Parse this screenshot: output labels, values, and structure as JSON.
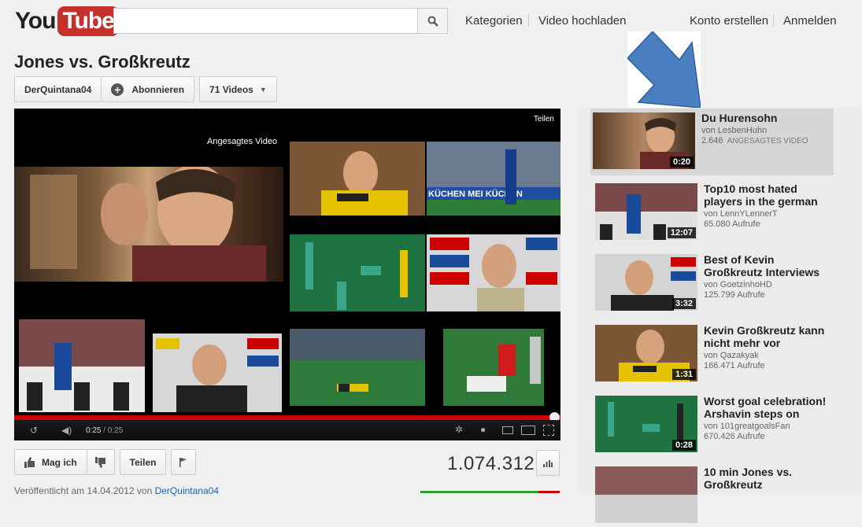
{
  "header": {
    "logo_you": "You",
    "logo_tube": "Tube",
    "search_placeholder": "",
    "nav": [
      "Kategorien",
      "Video hochladen"
    ],
    "account": [
      "Konto erstellen",
      "Anmelden"
    ]
  },
  "video": {
    "title": "Jones vs. Großkreutz",
    "channel": "DerQuintana04",
    "subscribe_label": "Abonnieren",
    "videos_count_label": "71 Videos",
    "views": "1.074.312",
    "published_prefix": "Veröffentlicht am 14.04.2012 von",
    "published_by": "DerQuintana04"
  },
  "player": {
    "share_label": "Teilen",
    "featured_label": "Angesagtes Video",
    "time_current": "0:25",
    "time_total": "/ 0:25",
    "progress_fraction": 0.98
  },
  "actions": {
    "like_label": "Mag ich",
    "share_label": "Teilen"
  },
  "colors": {
    "brand_red": "#c4302b",
    "link_blue": "#1c62b9",
    "arrow_blue": "#4a7fc1"
  },
  "sidebar": {
    "items": [
      {
        "title": "Du Hurensohn",
        "by": "von LesbenHuhn",
        "views": "2.646",
        "tag": "ANGESAGTES VIDEO",
        "duration": "0:20"
      },
      {
        "title": "Top10 most hated players in the german",
        "by": "von LennYLennerT",
        "views": "65.080 Aufrufe",
        "tag": "",
        "duration": "12:07"
      },
      {
        "title": "Best of Kevin Großkreutz Interviews",
        "by": "von GoetzinhoHD",
        "views": "125.799 Aufrufe",
        "tag": "",
        "duration": "3:32"
      },
      {
        "title": "Kevin Großkreutz kann nicht mehr vor",
        "by": "von Qazakyak",
        "views": "166.471 Aufrufe",
        "tag": "",
        "duration": "1:31"
      },
      {
        "title": "Worst goal celebration! Arshavin steps on",
        "by": "von 101greatgoalsFan",
        "views": "670.426 Aufrufe",
        "tag": "",
        "duration": "0:28"
      },
      {
        "title": "10 min Jones vs. Großkreutz",
        "by": "",
        "views": "",
        "tag": "",
        "duration": ""
      }
    ]
  }
}
